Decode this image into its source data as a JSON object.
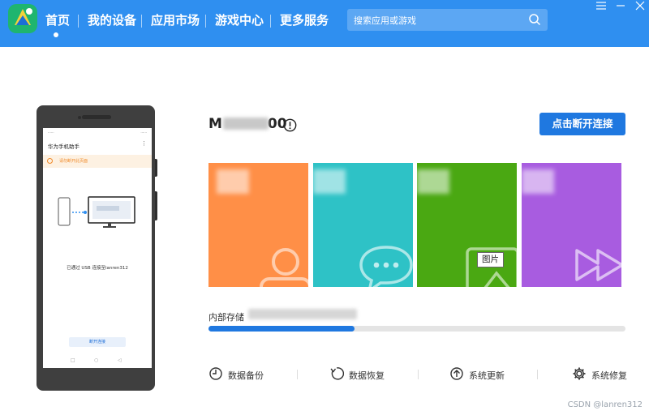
{
  "header": {
    "nav": [
      "首页",
      "我的设备",
      "应用市场",
      "游戏中心",
      "更多服务"
    ],
    "active_index": 0,
    "search_placeholder": "搜索应用或游戏"
  },
  "phone": {
    "app_title": "华为手机助手",
    "warning_text": "请勿断开此页面",
    "connected_text": "已通过 USB 连接至lanren312",
    "disconnect_label": "断开连接"
  },
  "device": {
    "name_prefix": "M",
    "name_suffix": "00",
    "disconnect_button": "点击断开连接"
  },
  "tiles": [
    {
      "color": "#ff8f47",
      "icon": "contacts-icon"
    },
    {
      "color": "#2ec2c6",
      "icon": "messages-icon"
    },
    {
      "color": "#4aa812",
      "icon": "pictures-icon"
    },
    {
      "color": "#a85ce0",
      "icon": "videos-icon"
    }
  ],
  "tooltip": "图片",
  "storage": {
    "label": "内部存储",
    "used_fraction": 0.35
  },
  "actions": [
    {
      "label": "数据备份",
      "icon": "backup-icon"
    },
    {
      "label": "数据恢复",
      "icon": "restore-icon"
    },
    {
      "label": "系统更新",
      "icon": "update-icon"
    },
    {
      "label": "系统修复",
      "icon": "gear-icon"
    }
  ],
  "watermark": "CSDN @lanren312",
  "colors": {
    "brand": "#2f8ff0",
    "accent": "#1f78e0"
  }
}
